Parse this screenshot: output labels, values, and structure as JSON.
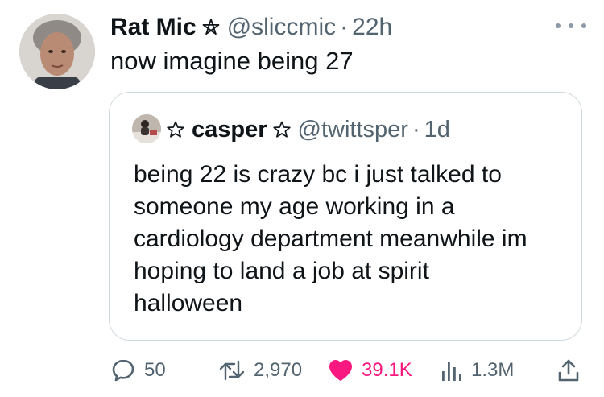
{
  "tweet": {
    "author_name": "Rat Mic",
    "handle": "@sliccmic",
    "separator": "·",
    "time": "22h",
    "text": "now imagine being 27"
  },
  "quote": {
    "author_name": "casper",
    "handle": "@twittsper",
    "separator": "·",
    "time": "1d",
    "text_lines": [
      "being 22 is crazy bc i just talked to",
      "someone my age working in a",
      "cardiology department meanwhile im",
      "hoping to land a job at spirit",
      "halloween"
    ]
  },
  "actions": {
    "replies": "50",
    "reposts": "2,970",
    "likes": "39.1K",
    "views": "1.3M"
  },
  "colors": {
    "text": "#0f1419",
    "secondary": "#536471",
    "like": "#f91880",
    "border": "#cfd9de"
  },
  "icons": [
    "pentagram-icon",
    "star-icon",
    "reply-icon",
    "repost-icon",
    "heart-icon",
    "views-icon",
    "share-icon",
    "more-icon"
  ]
}
